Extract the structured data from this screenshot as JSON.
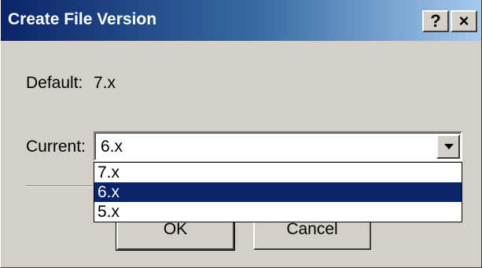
{
  "window": {
    "title": "Create File Version",
    "help_label": "?",
    "close_label": "×"
  },
  "form": {
    "default_label": "Default:",
    "default_value": "7.x",
    "current_label": "Current:",
    "current_value": "6.x"
  },
  "dropdown": {
    "options": [
      "7.x",
      "6.x",
      "5.x"
    ],
    "selected_index": 1
  },
  "buttons": {
    "ok_label": "OK",
    "cancel_label": "Cancel"
  },
  "colors": {
    "titlebar_start": "#0a246a",
    "titlebar_end": "#a6caf0",
    "face": "#d4d0c8",
    "highlight": "#0a246a"
  }
}
